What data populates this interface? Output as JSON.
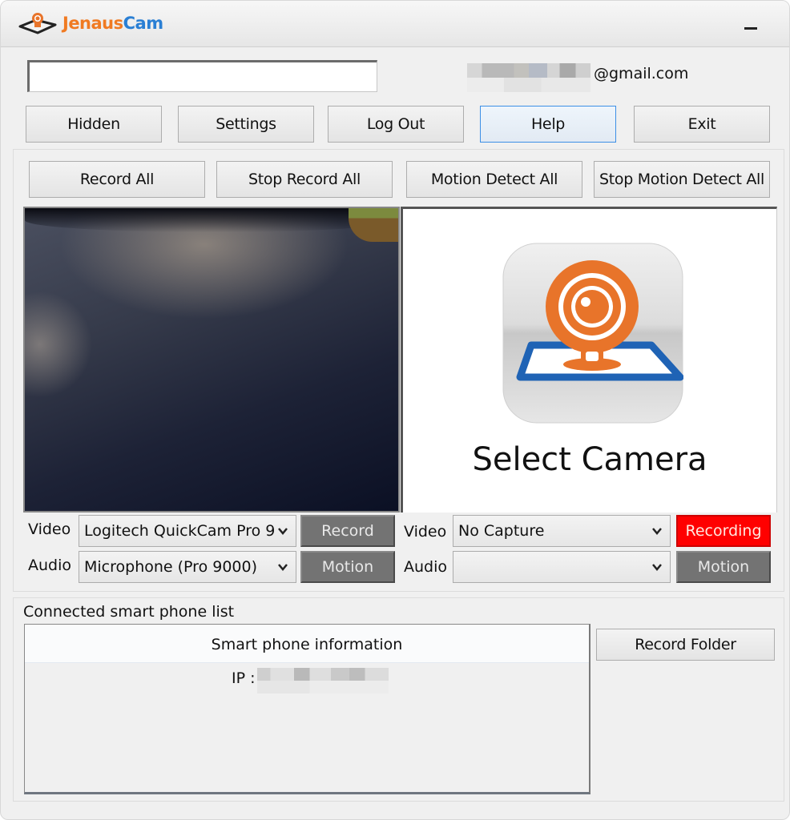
{
  "app": {
    "title_part1": "Jenaus",
    "title_part2": "Cam",
    "logo_icon": "webcam-logo-icon",
    "minimize_icon": "minimize-icon"
  },
  "account": {
    "input_value": "",
    "email_visible_suffix": "@gmail.com"
  },
  "toolbar": {
    "buttons": [
      {
        "label": "Hidden"
      },
      {
        "label": "Settings"
      },
      {
        "label": "Log Out"
      },
      {
        "label": "Help",
        "focused": true
      },
      {
        "label": "Exit"
      }
    ]
  },
  "global_actions": {
    "buttons": [
      {
        "label": "Record All"
      },
      {
        "label": "Stop Record All"
      },
      {
        "label": "Motion Detect All"
      },
      {
        "label": "Stop Motion Detect All"
      }
    ]
  },
  "cameras": [
    {
      "feed": "live-video",
      "video_label": "Video",
      "video_device": "Logitech QuickCam Pro 9",
      "audio_label": "Audio",
      "audio_device": "Microphone (Pro 9000)",
      "record_button": "Record",
      "record_state": "idle",
      "motion_button": "Motion"
    },
    {
      "feed": "placeholder",
      "placeholder_text": "Select Camera",
      "placeholder_icon": "select-camera-icon",
      "video_label": "Video",
      "video_device": "No Capture",
      "audio_label": "Audio",
      "audio_device": "",
      "record_button": "Recording",
      "record_state": "active",
      "motion_button": "Motion"
    }
  ],
  "phones": {
    "section_label": "Connected smart phone list",
    "column_header": "Smart phone information",
    "rows": [
      {
        "ip_label": "IP :",
        "ip_value_redacted": true
      }
    ],
    "record_folder_button": "Record Folder"
  },
  "colors": {
    "recording_active": "#ff0000",
    "state_button_idle": "#737373",
    "focus_border": "#3c8fe6",
    "brand_orange": "#f07a22",
    "brand_blue": "#2a7fd4"
  }
}
